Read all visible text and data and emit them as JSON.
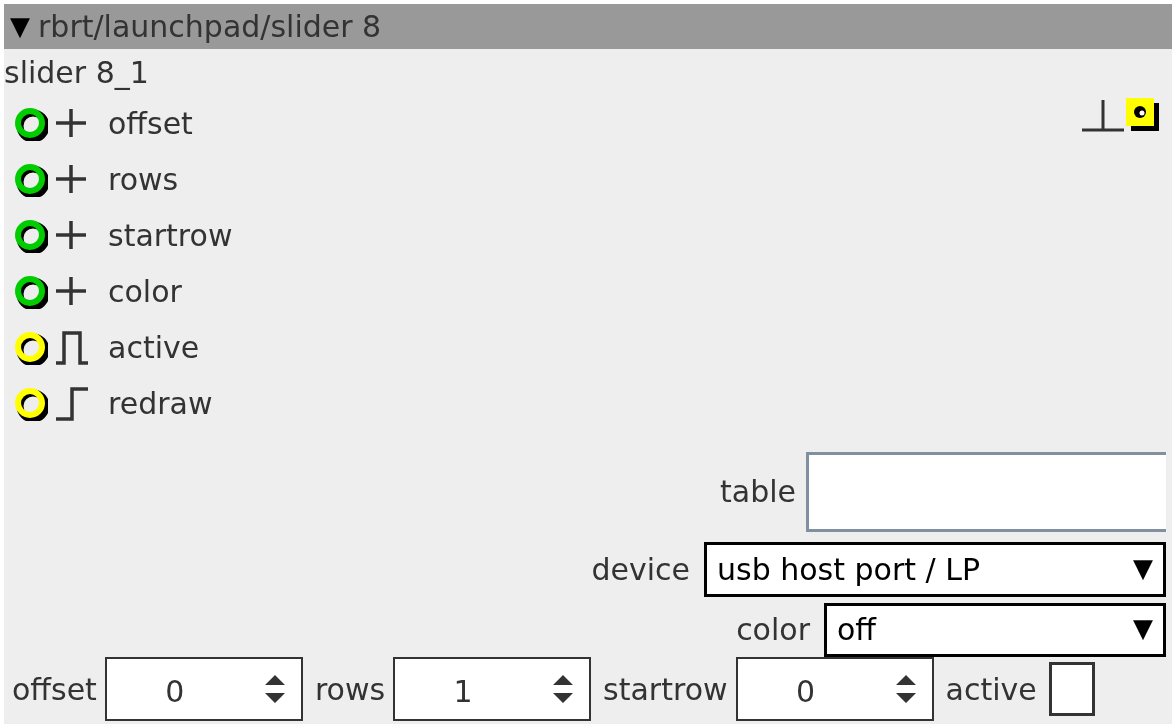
{
  "header": {
    "arrow": "▼",
    "title": "rbrt/launchpad/slider 8",
    "expanded": true
  },
  "instance": "slider 8_1",
  "inputs": [
    {
      "kind": "number",
      "name": "offset",
      "color": "#00cc00"
    },
    {
      "kind": "number",
      "name": "rows",
      "color": "#00cc00"
    },
    {
      "kind": "number",
      "name": "startrow",
      "color": "#00cc00"
    },
    {
      "kind": "number",
      "name": "color",
      "color": "#00cc00"
    },
    {
      "kind": "gate",
      "name": "active",
      "color": "#ffff00"
    },
    {
      "kind": "trigger",
      "name": "redraw",
      "color": "#ffff00"
    }
  ],
  "table": {
    "label": "table"
  },
  "device": {
    "label": "device",
    "value": "usb host port / LP",
    "arrow": "▼"
  },
  "color": {
    "label": "color",
    "value": "off",
    "arrow": "▼"
  },
  "params": [
    {
      "kind": "spin",
      "label": "offset",
      "value": "0"
    },
    {
      "kind": "spin",
      "label": "rows",
      "value": "1"
    },
    {
      "kind": "spin",
      "label": "startrow",
      "value": "0"
    },
    {
      "kind": "check",
      "label": "active",
      "checked": false
    }
  ]
}
